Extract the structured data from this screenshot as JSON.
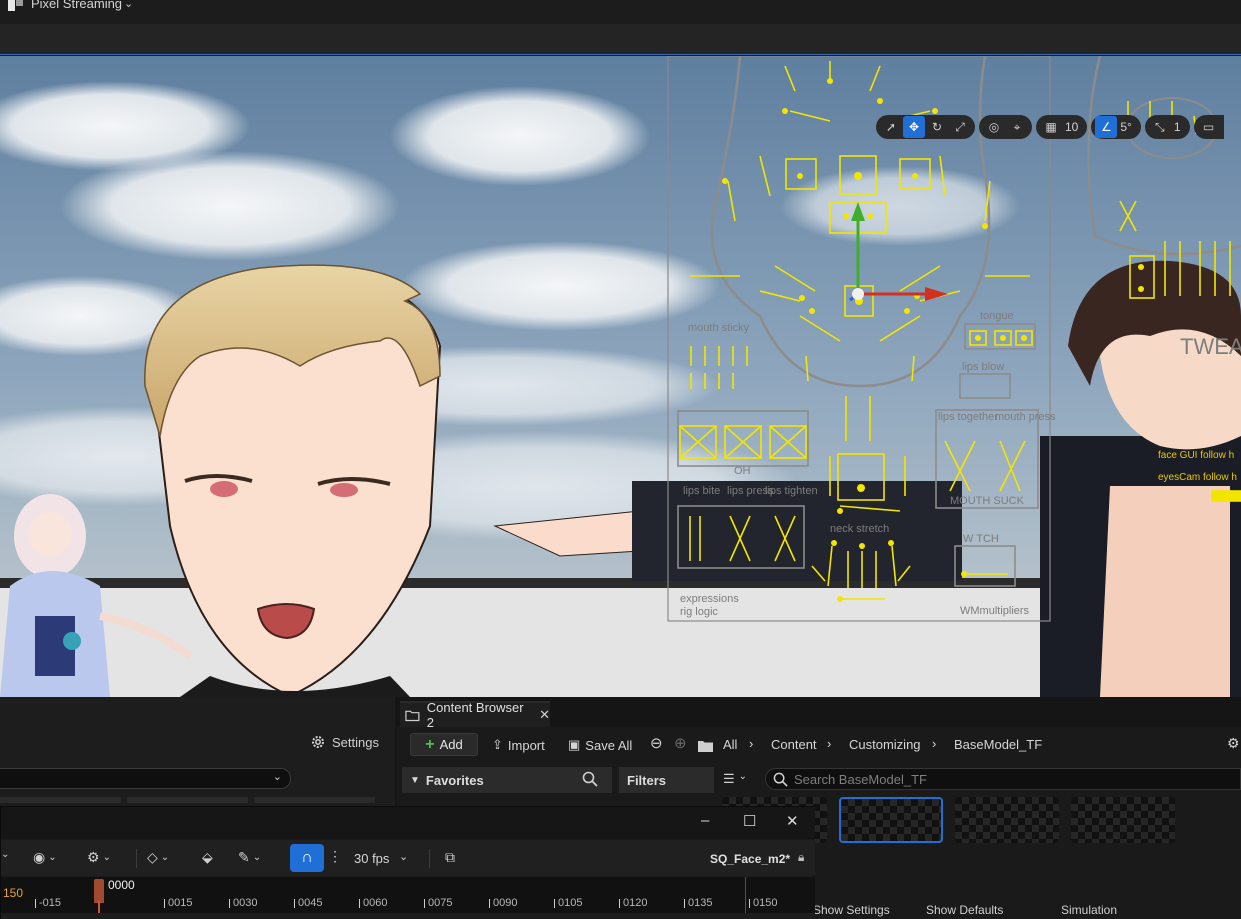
{
  "app": {
    "title": "Pixel Streaming"
  },
  "viewport_toolbar": {
    "grid_value": "10",
    "rotation_value": "5°",
    "scale_value": "1"
  },
  "rig_labels": {
    "mouth_sticky": "mouth sticky",
    "tongue": "tongue",
    "lips_blow": "lips blow",
    "lips_together": "lips together",
    "mouth_press": "mouth press",
    "mouth_suck": "MOUTH SUCK",
    "oh": "OH",
    "lips_bite": "lips bite",
    "lips_press": "lips press",
    "lips_tighten": "lips tighten",
    "neck_stretch": "neck stretch",
    "wtch": "W TCH",
    "expressions": "expressions",
    "rig_logic": "rig logic",
    "wm_multipliers": "WMmultipliers",
    "tweak": "TWEA",
    "face_gui_follow": "face GUI follow h",
    "eyes_cam_follow": "eyesCam follow h"
  },
  "left_panel": {
    "settings_label": "Settings"
  },
  "content_browser": {
    "tab_label": "Content Browser 2",
    "add_label": "Add",
    "import_label": "Import",
    "save_all_label": "Save All",
    "breadcrumbs": [
      "All",
      "Content",
      "Customizing",
      "BaseModel_TF"
    ],
    "favorites_label": "Favorites",
    "filters_label": "Filters",
    "search_placeholder": "Search BaseModel_TF",
    "bottom_items": [
      "Show Settings",
      "Show Defaults",
      "Simulation"
    ]
  },
  "sequencer": {
    "fps_label": "30 fps",
    "sequence_name": "SQ_Face_m2*",
    "current_frame": "0000",
    "frame_left": "150",
    "ticks": [
      "-015",
      "0015",
      "0030",
      "0045",
      "0060",
      "0075",
      "0090",
      "0105",
      "0120",
      "0135",
      "0150"
    ]
  },
  "colors": {
    "accent": "#1f6fd6",
    "rig_yellow": "#f2e600",
    "playhead": "#a04a30",
    "end_marker": "#b5262b"
  }
}
